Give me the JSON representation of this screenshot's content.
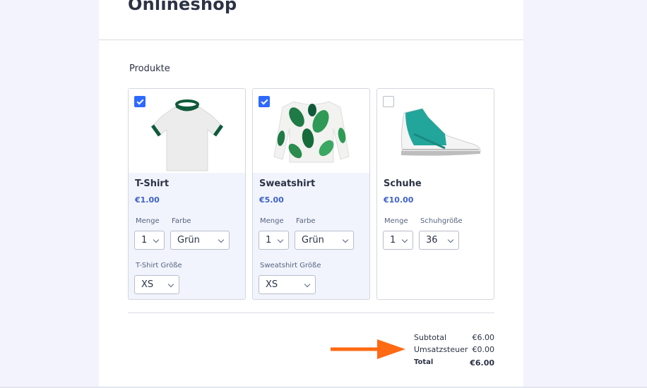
{
  "form": {
    "title": "Onlineshop",
    "section_label": "Produkte"
  },
  "products": [
    {
      "name": "T-Shirt",
      "price": "€1.00",
      "selected": true,
      "image": "tshirt-image",
      "options": {
        "quantity_label": "Menge",
        "quantity_value": "1",
        "color_label": "Farbe",
        "color_value": "Grün",
        "size_label": "T-Shirt Größe",
        "size_value": "XS"
      }
    },
    {
      "name": "Sweatshirt",
      "price": "€5.00",
      "selected": true,
      "image": "sweatshirt-image",
      "options": {
        "quantity_label": "Menge",
        "quantity_value": "1",
        "color_label": "Farbe",
        "color_value": "Grün",
        "size_label": "Sweatshirt Größe",
        "size_value": "XS"
      }
    },
    {
      "name": "Schuhe",
      "price": "€10.00",
      "selected": false,
      "image": "shoe-image",
      "options": {
        "quantity_label": "Menge",
        "quantity_value": "1",
        "size_label": "Schuhgröße",
        "size_value": "36"
      }
    }
  ],
  "totals": {
    "subtotal_label": "Subtotal",
    "subtotal_value": "€6.00",
    "tax_label": "Umsatzsteuer",
    "tax_value": "€0.00",
    "total_label": "Total",
    "total_value": "€6.00"
  },
  "colors": {
    "accent": "#2e69ff",
    "price": "#3e62c8",
    "arrow": "#ff6a13",
    "background": "#f3f3fe"
  }
}
